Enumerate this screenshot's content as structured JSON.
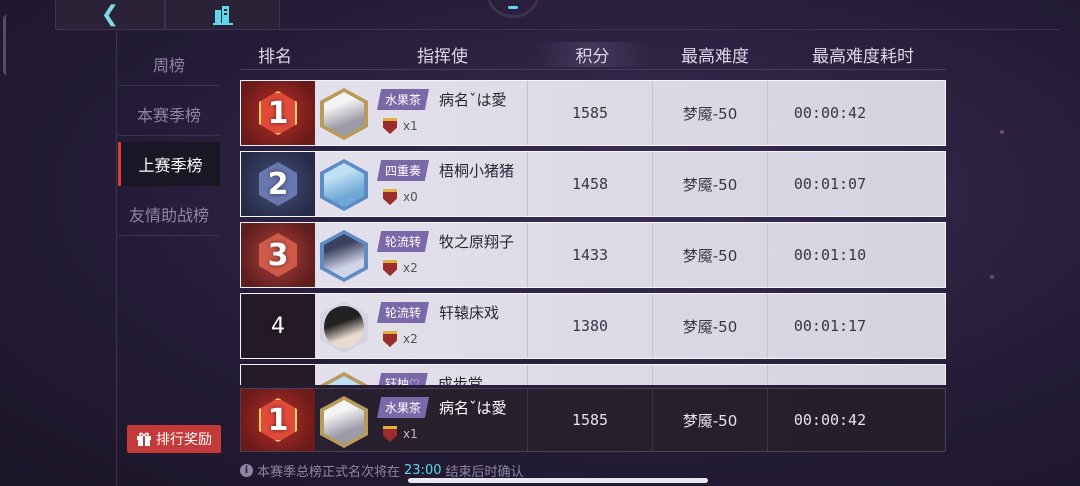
{
  "topbar": {
    "back_icon": "back-arrow-icon",
    "home_icon": "building-icon"
  },
  "sidebar": {
    "items": [
      {
        "label": "周榜"
      },
      {
        "label": "本赛季榜"
      },
      {
        "label": "上赛季榜"
      },
      {
        "label": "友情助战榜"
      }
    ],
    "active_index": 2,
    "reward_button": "排行奖励"
  },
  "header": {
    "rank": "排名",
    "commander": "指挥使",
    "score": "积分",
    "difficulty": "最高难度",
    "time": "最高难度耗时"
  },
  "rows": [
    {
      "rank": "1",
      "tag": "水果茶",
      "name": "病名ˇは愛",
      "medals": "x1",
      "score": "1585",
      "difficulty": "梦魇-50",
      "time": "00:00:42"
    },
    {
      "rank": "2",
      "tag": "四重奏",
      "name": "梧桐小猪猪",
      "medals": "x0",
      "score": "1458",
      "difficulty": "梦魇-50",
      "time": "00:01:07"
    },
    {
      "rank": "3",
      "tag": "轮流转",
      "name": "牧之原翔子",
      "medals": "x2",
      "score": "1433",
      "difficulty": "梦魇-50",
      "time": "00:01:10"
    },
    {
      "rank": "4",
      "tag": "轮流转",
      "name": "轩辕床戏",
      "medals": "x2",
      "score": "1380",
      "difficulty": "梦魇-50",
      "time": "00:01:17"
    },
    {
      "rank": "",
      "tag": "钰柚♡",
      "name": "成步堂",
      "medals": "",
      "score": "",
      "difficulty": "",
      "time": ""
    }
  ],
  "my_row": {
    "rank": "1",
    "tag": "水果茶",
    "name": "病名ˇは愛",
    "medals": "x1",
    "score": "1585",
    "difficulty": "梦魇-50",
    "time": "00:00:42"
  },
  "notice": {
    "text_before": "本赛季总榜正式名次将在",
    "time": "23:00",
    "text_after": "结束后时确认"
  },
  "colors": {
    "accent_red": "#c43a3a",
    "highlight_cyan": "#5ed8ea",
    "team_tag": "#7a68a8"
  }
}
